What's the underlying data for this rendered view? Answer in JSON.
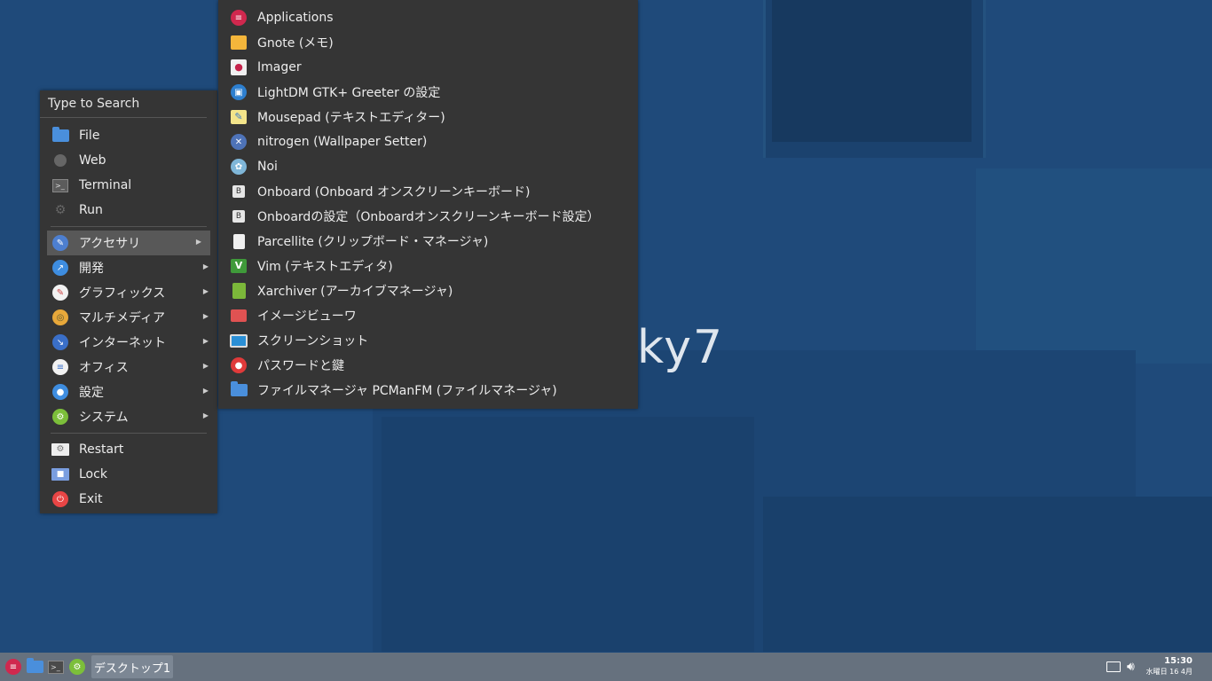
{
  "desktop": {
    "logo_text": "ky7"
  },
  "menu": {
    "search_placeholder": "Type to Search",
    "top_items": [
      {
        "label": "File",
        "icon": "folder-icon"
      },
      {
        "label": "Web",
        "icon": "globe-icon"
      },
      {
        "label": "Terminal",
        "icon": "terminal-icon"
      },
      {
        "label": "Run",
        "icon": "gear-icon"
      }
    ],
    "categories": [
      {
        "label": "アクセサリ",
        "icon": "accessories-icon",
        "selected": true
      },
      {
        "label": "開発",
        "icon": "development-icon"
      },
      {
        "label": "グラフィックス",
        "icon": "graphics-icon"
      },
      {
        "label": "マルチメディア",
        "icon": "multimedia-icon"
      },
      {
        "label": "インターネット",
        "icon": "internet-icon"
      },
      {
        "label": "オフィス",
        "icon": "office-icon"
      },
      {
        "label": "設定",
        "icon": "settings-icon"
      },
      {
        "label": "システム",
        "icon": "system-icon"
      }
    ],
    "session": [
      {
        "label": "Restart",
        "icon": "restart-icon"
      },
      {
        "label": "Lock",
        "icon": "lock-icon"
      },
      {
        "label": "Exit",
        "icon": "power-icon"
      }
    ]
  },
  "submenu": {
    "items": [
      {
        "label": "Applications",
        "icon": "applications-icon"
      },
      {
        "label": "Gnote (メモ)",
        "icon": "note-icon"
      },
      {
        "label": "Imager",
        "icon": "raspberry-icon"
      },
      {
        "label": "LightDM GTK+ Greeter の設定",
        "icon": "lightdm-icon"
      },
      {
        "label": "Mousepad (テキストエディター)",
        "icon": "mousepad-icon"
      },
      {
        "label": "nitrogen (Wallpaper Setter)",
        "icon": "nitrogen-icon"
      },
      {
        "label": "Noi",
        "icon": "noi-icon"
      },
      {
        "label": "Onboard (Onboard オンスクリーンキーボード)",
        "icon": "keyboard-icon"
      },
      {
        "label": "Onboardの設定（Onboardオンスクリーンキーボード設定）",
        "icon": "keyboard-settings-icon"
      },
      {
        "label": "Parcellite (クリップボード・マネージャ)",
        "icon": "clipboard-icon"
      },
      {
        "label": "Vim (テキストエディタ)",
        "icon": "vim-icon"
      },
      {
        "label": "Xarchiver (アーカイブマネージャ)",
        "icon": "archive-icon"
      },
      {
        "label": "イメージビューワ",
        "icon": "image-viewer-icon"
      },
      {
        "label": "スクリーンショット",
        "icon": "screenshot-icon"
      },
      {
        "label": "パスワードと鍵",
        "icon": "password-icon"
      },
      {
        "label": "ファイルマネージャ PCManFM (ファイルマネージャ)",
        "icon": "file-manager-icon"
      }
    ]
  },
  "taskbar": {
    "task_label": "デスクトップ1",
    "clock_time": "15:30",
    "clock_date": "水曜日 16 4月"
  }
}
